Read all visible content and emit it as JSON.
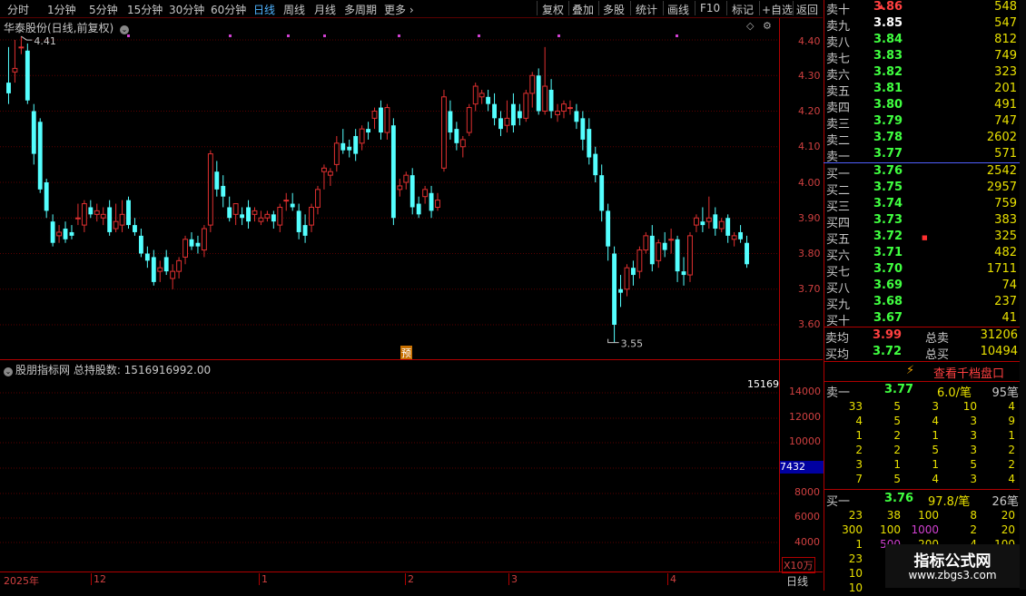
{
  "toolbar": {
    "periods": [
      "分时",
      "1分钟",
      "5分钟",
      "15分钟",
      "30分钟",
      "60分钟",
      "日线",
      "周线",
      "月线",
      "多周期"
    ],
    "more": "更多",
    "active": "日线",
    "tools": [
      "复权",
      "叠加",
      "多股",
      "统计",
      "画线",
      "F10",
      "标记",
      "+自选",
      "返回"
    ]
  },
  "chart": {
    "stock_title": "华泰股份(日线,前复权)",
    "y_ticks": [
      "4.40",
      "4.30",
      "4.20",
      "4.10",
      "4.00",
      "3.90",
      "3.80",
      "3.70",
      "3.60"
    ],
    "high_label": "4.41",
    "low_label": "3.55",
    "yu_marker": "预",
    "x_labels": [
      "2025年",
      "12",
      "1",
      "2",
      "3",
      "4"
    ],
    "up_color": "#e03030",
    "down_color": "#54ffff"
  },
  "chart_data": {
    "type": "candlestick",
    "y_range": [
      3.55,
      4.45
    ],
    "candles": [
      [
        4.28,
        4.38,
        4.25,
        4.22
      ],
      [
        4.31,
        4.4,
        4.32,
        4.28
      ],
      [
        4.38,
        4.41,
        4.38,
        4.36
      ],
      [
        4.37,
        4.39,
        4.23,
        4.22
      ],
      [
        4.2,
        4.22,
        4.08,
        4.05
      ],
      [
        4.17,
        4.18,
        3.98,
        3.97
      ],
      [
        4.0,
        4.01,
        3.92,
        3.9
      ],
      [
        3.89,
        3.91,
        3.83,
        3.82
      ],
      [
        3.85,
        3.88,
        3.86,
        3.83
      ],
      [
        3.87,
        3.89,
        3.84,
        3.83
      ],
      [
        3.86,
        3.88,
        3.85,
        3.84
      ],
      [
        3.9,
        3.94,
        3.9,
        3.88
      ],
      [
        3.88,
        3.95,
        3.94,
        3.86
      ],
      [
        3.93,
        3.95,
        3.91,
        3.9
      ],
      [
        3.91,
        3.94,
        3.92,
        3.89
      ],
      [
        3.9,
        3.93,
        3.91,
        3.88
      ],
      [
        3.93,
        3.95,
        3.86,
        3.85
      ],
      [
        3.87,
        3.94,
        3.89,
        3.86
      ],
      [
        3.88,
        3.95,
        3.91,
        3.86
      ],
      [
        3.95,
        3.96,
        3.88,
        3.87
      ],
      [
        3.88,
        3.9,
        3.86,
        3.85
      ],
      [
        3.85,
        3.87,
        3.8,
        3.79
      ],
      [
        3.8,
        3.82,
        3.78,
        3.76
      ],
      [
        3.79,
        3.81,
        3.72,
        3.71
      ],
      [
        3.75,
        3.78,
        3.76,
        3.72
      ],
      [
        3.79,
        3.81,
        3.75,
        3.74
      ],
      [
        3.73,
        3.77,
        3.75,
        3.7
      ],
      [
        3.75,
        3.79,
        3.78,
        3.73
      ],
      [
        3.79,
        3.85,
        3.84,
        3.77
      ],
      [
        3.84,
        3.86,
        3.82,
        3.81
      ],
      [
        3.83,
        3.85,
        3.82,
        3.8
      ],
      [
        3.81,
        3.88,
        3.87,
        3.79
      ],
      [
        3.88,
        4.09,
        4.08,
        3.86
      ],
      [
        4.03,
        4.06,
        3.98,
        3.96
      ],
      [
        3.99,
        4.02,
        3.96,
        3.93
      ],
      [
        3.93,
        3.96,
        3.9,
        3.89
      ],
      [
        3.91,
        3.93,
        3.94,
        3.88
      ],
      [
        3.91,
        3.93,
        3.9,
        3.88
      ],
      [
        3.93,
        3.95,
        3.89,
        3.87
      ],
      [
        3.91,
        3.93,
        3.92,
        3.89
      ],
      [
        3.89,
        3.92,
        3.9,
        3.88
      ],
      [
        3.9,
        3.92,
        3.91,
        3.89
      ],
      [
        3.91,
        3.92,
        3.89,
        3.87
      ],
      [
        3.88,
        3.94,
        3.93,
        3.86
      ],
      [
        3.95,
        3.97,
        3.95,
        3.92
      ],
      [
        3.94,
        3.97,
        3.93,
        3.92
      ],
      [
        3.92,
        3.94,
        3.86,
        3.84
      ],
      [
        3.88,
        3.91,
        3.85,
        3.83
      ],
      [
        3.88,
        3.94,
        3.93,
        3.86
      ],
      [
        3.93,
        3.99,
        3.98,
        3.91
      ],
      [
        4.03,
        4.05,
        4.04,
        3.98
      ],
      [
        4.02,
        4.04,
        4.03,
        3.99
      ],
      [
        4.05,
        4.13,
        4.11,
        4.03
      ],
      [
        4.11,
        4.15,
        4.09,
        4.08
      ],
      [
        4.1,
        4.12,
        4.09,
        4.07
      ],
      [
        4.13,
        4.15,
        4.08,
        4.06
      ],
      [
        4.11,
        4.16,
        4.15,
        4.09
      ],
      [
        4.15,
        4.17,
        4.14,
        4.12
      ],
      [
        4.18,
        4.21,
        4.2,
        4.15
      ],
      [
        4.21,
        4.23,
        4.14,
        4.12
      ],
      [
        4.14,
        4.22,
        4.21,
        4.12
      ],
      [
        4.16,
        4.18,
        3.9,
        3.88
      ],
      [
        3.98,
        4.01,
        3.99,
        3.96
      ],
      [
        4.0,
        4.03,
        4.02,
        3.98
      ],
      [
        4.02,
        4.04,
        3.93,
        3.91
      ],
      [
        3.94,
        3.96,
        3.91,
        3.9
      ],
      [
        3.96,
        3.99,
        3.98,
        3.94
      ],
      [
        3.97,
        3.99,
        3.92,
        3.9
      ],
      [
        3.93,
        3.97,
        3.95,
        3.92
      ],
      [
        4.04,
        4.26,
        4.24,
        4.03
      ],
      [
        4.2,
        4.23,
        4.14,
        4.12
      ],
      [
        4.15,
        4.17,
        4.11,
        4.09
      ],
      [
        4.1,
        4.13,
        4.12,
        4.07
      ],
      [
        4.14,
        4.22,
        4.21,
        4.13
      ],
      [
        4.22,
        4.28,
        4.27,
        4.2
      ],
      [
        4.24,
        4.26,
        4.25,
        4.22
      ],
      [
        4.24,
        4.26,
        4.22,
        4.2
      ],
      [
        4.22,
        4.25,
        4.18,
        4.16
      ],
      [
        4.18,
        4.2,
        4.15,
        4.13
      ],
      [
        4.16,
        4.23,
        4.18,
        4.14
      ],
      [
        4.22,
        4.25,
        4.16,
        4.14
      ],
      [
        4.2,
        4.22,
        4.18,
        4.16
      ],
      [
        4.18,
        4.26,
        4.25,
        4.17
      ],
      [
        4.25,
        4.31,
        4.3,
        4.21
      ],
      [
        4.3,
        4.32,
        4.2,
        4.19
      ],
      [
        4.2,
        4.38,
        4.27,
        4.19
      ],
      [
        4.26,
        4.29,
        4.2,
        4.18
      ],
      [
        4.19,
        4.22,
        4.2,
        4.17
      ],
      [
        4.2,
        4.23,
        4.22,
        4.18
      ],
      [
        4.21,
        4.23,
        4.21,
        4.19
      ],
      [
        4.2,
        4.22,
        4.17,
        4.15
      ],
      [
        4.18,
        4.2,
        4.12,
        4.09
      ],
      [
        4.15,
        4.18,
        4.07,
        4.05
      ],
      [
        4.08,
        4.1,
        4.02,
        4.0
      ],
      [
        4.02,
        4.05,
        3.92,
        3.89
      ],
      [
        3.92,
        3.94,
        3.82,
        3.78
      ],
      [
        3.8,
        3.82,
        3.6,
        3.55
      ],
      [
        3.7,
        3.74,
        3.69,
        3.65
      ],
      [
        3.7,
        3.77,
        3.76,
        3.68
      ],
      [
        3.76,
        3.78,
        3.74,
        3.71
      ],
      [
        3.75,
        3.82,
        3.81,
        3.73
      ],
      [
        3.81,
        3.86,
        3.85,
        3.8
      ],
      [
        3.85,
        3.88,
        3.77,
        3.75
      ],
      [
        3.78,
        3.84,
        3.83,
        3.76
      ],
      [
        3.83,
        3.86,
        3.81,
        3.79
      ],
      [
        3.84,
        3.87,
        3.84,
        3.8
      ],
      [
        3.84,
        3.85,
        3.75,
        3.72
      ],
      [
        3.75,
        3.79,
        3.74,
        3.71
      ],
      [
        3.74,
        3.86,
        3.85,
        3.72
      ],
      [
        3.88,
        3.91,
        3.9,
        3.86
      ],
      [
        3.89,
        3.93,
        3.88,
        3.86
      ],
      [
        3.89,
        3.96,
        3.9,
        3.87
      ],
      [
        3.91,
        3.93,
        3.87,
        3.85
      ],
      [
        3.87,
        3.9,
        3.89,
        3.86
      ],
      [
        3.9,
        3.91,
        3.85,
        3.83
      ],
      [
        3.84,
        3.86,
        3.85,
        3.82
      ],
      [
        3.86,
        3.88,
        3.84,
        3.83
      ],
      [
        3.83,
        3.85,
        3.77,
        3.76
      ]
    ]
  },
  "sub_chart": {
    "title": "股朋指标网 总持股数: 1516916992.00",
    "value_clip": "15169",
    "highlight_value": "7432",
    "y_ticks": [
      "14000",
      "12000",
      "10000",
      "8000",
      "6000",
      "4000",
      "2000"
    ],
    "unit": "X10万",
    "period_label": "日线"
  },
  "order_book": {
    "asks": [
      {
        "label": "卖十",
        "price": "3.86",
        "vol": "548"
      },
      {
        "label": "卖九",
        "price": "3.85",
        "vol": "547"
      },
      {
        "label": "卖八",
        "price": "3.84",
        "vol": "812"
      },
      {
        "label": "卖七",
        "price": "3.83",
        "vol": "749"
      },
      {
        "label": "卖六",
        "price": "3.82",
        "vol": "323"
      },
      {
        "label": "卖五",
        "price": "3.81",
        "vol": "201"
      },
      {
        "label": "卖四",
        "price": "3.80",
        "vol": "491"
      },
      {
        "label": "卖三",
        "price": "3.79",
        "vol": "747"
      },
      {
        "label": "卖二",
        "price": "3.78",
        "vol": "2602"
      },
      {
        "label": "卖一",
        "price": "3.77",
        "vol": "571"
      }
    ],
    "bids": [
      {
        "label": "买一",
        "price": "3.76",
        "vol": "2542"
      },
      {
        "label": "买二",
        "price": "3.75",
        "vol": "2957"
      },
      {
        "label": "买三",
        "price": "3.74",
        "vol": "759"
      },
      {
        "label": "买四",
        "price": "3.73",
        "vol": "383"
      },
      {
        "label": "买五",
        "price": "3.72",
        "vol": "325"
      },
      {
        "label": "买六",
        "price": "3.71",
        "vol": "482"
      },
      {
        "label": "买七",
        "price": "3.70",
        "vol": "1711"
      },
      {
        "label": "买八",
        "price": "3.69",
        "vol": "74"
      },
      {
        "label": "买九",
        "price": "3.68",
        "vol": "237"
      },
      {
        "label": "买十",
        "price": "3.67",
        "vol": "41"
      }
    ],
    "ask_avg_label": "卖均",
    "ask_avg": "3.99",
    "total_ask_label": "总卖",
    "total_ask": "31206",
    "bid_avg_label": "买均",
    "bid_avg": "3.72",
    "total_bid_label": "总买",
    "total_bid": "10494"
  },
  "detail": {
    "link": "查看千档盘口",
    "ask1": {
      "label": "卖一",
      "price": "3.77",
      "per": "6.0/笔",
      "count": "95笔"
    },
    "ask_grid": [
      [
        "33",
        "5",
        "3",
        "10",
        "4"
      ],
      [
        "4",
        "5",
        "4",
        "3",
        "9"
      ],
      [
        "1",
        "2",
        "1",
        "3",
        "1"
      ],
      [
        "2",
        "2",
        "5",
        "3",
        "2"
      ],
      [
        "3",
        "1",
        "1",
        "5",
        "2"
      ],
      [
        "7",
        "5",
        "4",
        "3",
        "4"
      ]
    ],
    "bid1": {
      "label": "买一",
      "price": "3.76",
      "per": "97.8/笔",
      "count": "26笔"
    },
    "bid_grid": [
      [
        "23",
        "38",
        "100",
        "8",
        "20"
      ],
      [
        "300",
        "100",
        "1000",
        "2",
        "20"
      ],
      [
        "1",
        "500",
        "200",
        "4",
        "100"
      ],
      [
        "23",
        "",
        "",
        "",
        ""
      ],
      [
        "10",
        "",
        "",
        "",
        ""
      ],
      [
        "10",
        "",
        "",
        "",
        ""
      ]
    ],
    "watermark_title": "指标公式网",
    "watermark_url": "www.zbgs3.com"
  }
}
